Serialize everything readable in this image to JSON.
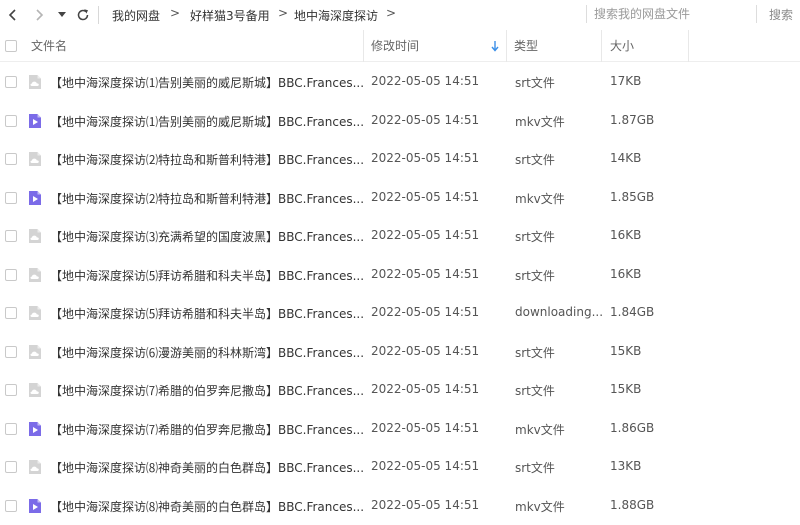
{
  "nav": {
    "breadcrumbs": [
      "我的网盘",
      "好样猫3号备用",
      "地中海深度探访"
    ],
    "separator": ">"
  },
  "search": {
    "placeholder": "搜索我的网盘文件",
    "button_label": "搜索"
  },
  "columns": {
    "name": "文件名",
    "modified": "修改时间",
    "type": "类型",
    "size": "大小"
  },
  "colors": {
    "video_icon": "#7b6be8",
    "subtitle_icon": "#d4d4d4",
    "sort_arrow": "#3a8fe8"
  },
  "files": [
    {
      "name": "【地中海深度探访⑴告别美丽的威尼斯城】BBC.Frances...",
      "date": "2022-05-05 14:51",
      "type": "srt文件",
      "size": "17KB",
      "icon": "subtitle-file-icon"
    },
    {
      "name": "【地中海深度探访⑴告别美丽的威尼斯城】BBC.Frances...",
      "date": "2022-05-05 14:51",
      "type": "mkv文件",
      "size": "1.87GB",
      "icon": "video-file-icon"
    },
    {
      "name": "【地中海深度探访⑵特拉岛和斯普利特港】BBC.Frances...",
      "date": "2022-05-05 14:51",
      "type": "srt文件",
      "size": "14KB",
      "icon": "subtitle-file-icon"
    },
    {
      "name": "【地中海深度探访⑵特拉岛和斯普利特港】BBC.Frances...",
      "date": "2022-05-05 14:51",
      "type": "mkv文件",
      "size": "1.85GB",
      "icon": "video-file-icon"
    },
    {
      "name": "【地中海深度探访⑶充满希望的国度波黑】BBC.Frances...",
      "date": "2022-05-05 14:51",
      "type": "srt文件",
      "size": "16KB",
      "icon": "subtitle-file-icon"
    },
    {
      "name": "【地中海深度探访⑸拜访希腊和科夫半岛】BBC.Frances...",
      "date": "2022-05-05 14:51",
      "type": "srt文件",
      "size": "16KB",
      "icon": "subtitle-file-icon"
    },
    {
      "name": "【地中海深度探访⑸拜访希腊和科夫半岛】BBC.Frances...",
      "date": "2022-05-05 14:51",
      "type": "downloading...",
      "size": "1.84GB",
      "icon": "subtitle-file-icon"
    },
    {
      "name": "【地中海深度探访⑹漫游美丽的科林斯湾】BBC.Frances...",
      "date": "2022-05-05 14:51",
      "type": "srt文件",
      "size": "15KB",
      "icon": "subtitle-file-icon"
    },
    {
      "name": "【地中海深度探访⑺希腊的伯罗奔尼撒岛】BBC.Frances...",
      "date": "2022-05-05 14:51",
      "type": "srt文件",
      "size": "15KB",
      "icon": "subtitle-file-icon"
    },
    {
      "name": "【地中海深度探访⑺希腊的伯罗奔尼撒岛】BBC.Frances...",
      "date": "2022-05-05 14:51",
      "type": "mkv文件",
      "size": "1.86GB",
      "icon": "video-file-icon"
    },
    {
      "name": "【地中海深度探访⑻神奇美丽的白色群岛】BBC.Frances...",
      "date": "2022-05-05 14:51",
      "type": "srt文件",
      "size": "13KB",
      "icon": "subtitle-file-icon"
    },
    {
      "name": "【地中海深度探访⑻神奇美丽的白色群岛】BBC.Frances...",
      "date": "2022-05-05 14:51",
      "type": "mkv文件",
      "size": "1.88GB",
      "icon": "video-file-icon"
    }
  ]
}
